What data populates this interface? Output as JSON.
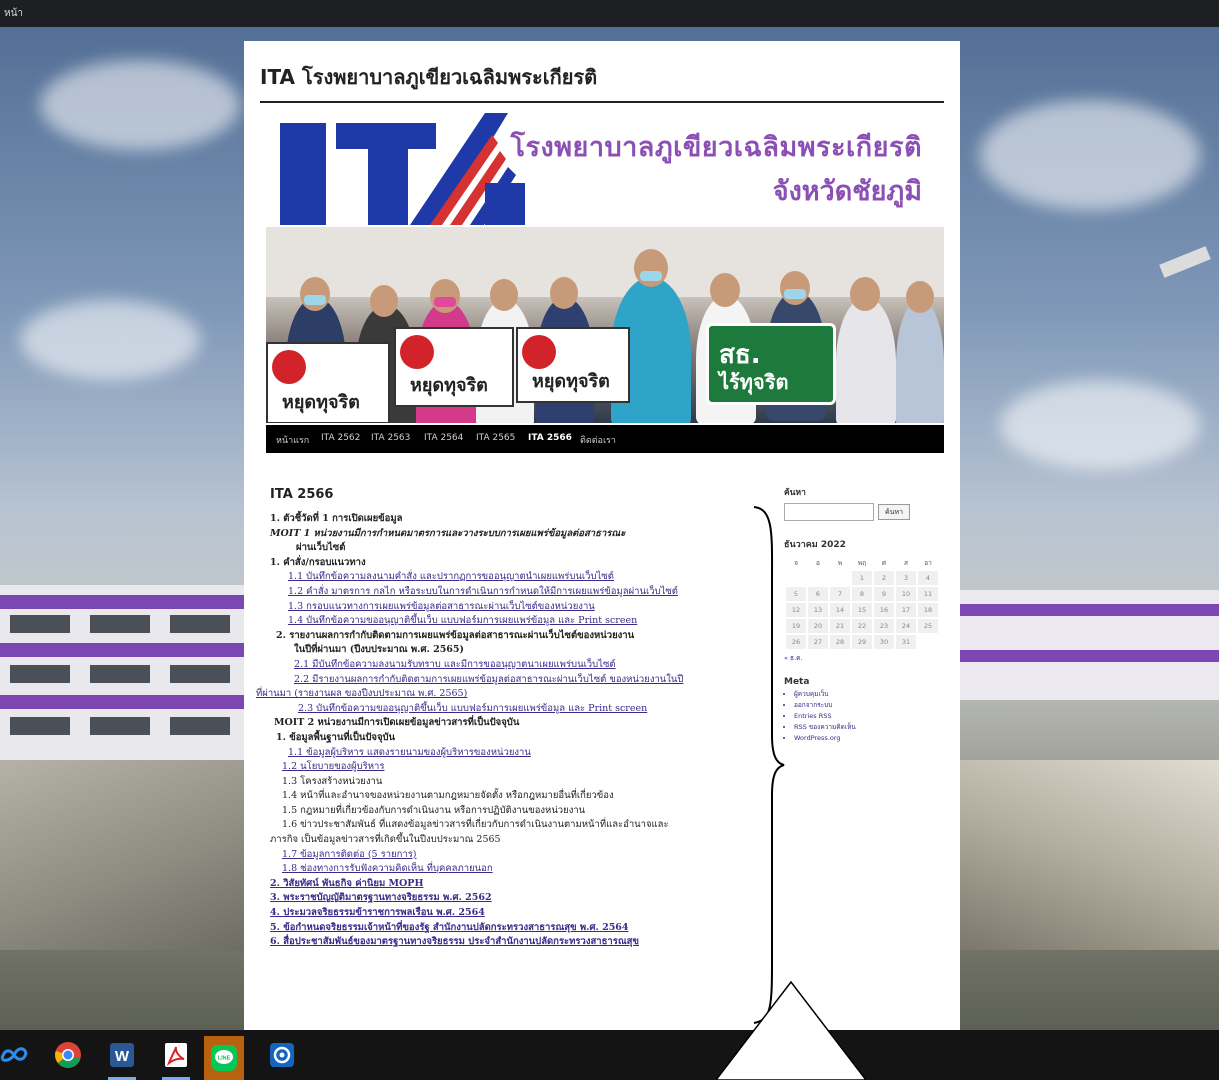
{
  "browser": {
    "tab_text": "หน้า"
  },
  "site": {
    "title": "ITA โรงพยาบาลภูเขียวเฉลิมพระเกียรติ",
    "banner_line1": "โรงพยาบาลภูเขียวเฉลิมพระเกียรติ",
    "banner_line2": "จังหวัดชัยภูมิ",
    "logo_text": "ITA"
  },
  "photo": {
    "sign_text": "หยุดทุจริต",
    "green_sign_1": "สธ.",
    "green_sign_2": "ไร้ทุจริต"
  },
  "nav": {
    "items": [
      "หน้าแรก",
      "ITA 2562",
      "ITA 2563",
      "ITA 2564",
      "ITA 2565",
      "ITA 2566",
      "ติดต่อเรา"
    ],
    "active": "ITA 2566"
  },
  "post": {
    "title": "ITA 2566",
    "lines": [
      "1. ตัวชี้วัดที่ 1 การเปิดเผยข้อมูล",
      "MOIT 1 หน่วยงานมีการกำหนดมาตรการและวางระบบการเผยแพร่ข้อมูลต่อสาธารณะ",
      "ผ่านเว็บไซต์",
      "1. คำสั่ง/กรอบแนวทาง",
      "1.1 บันทึกข้อความลงนามคำสั่ง และปรากฏการขออนุญาตนำเผยแพร่บนเว็บไซต์",
      "1.2 คำสั่ง มาตรการ กลไก หรือระบบในการดำเนินการกำหนดให้มีการเผยแพร่ข้อมูลผ่านเว็บไซต์",
      "1.3 กรอบแนวทางการเผยแพร่ข้อมูลต่อสาธารณะผ่านเว็บไซต์ของหน่วยงาน",
      "1.4 บันทึกข้อความขออนุญาติขึ้นเว็บ แบบฟอร์มการเผยแพร่ข้อมูล และ Print screen",
      "2. รายงานผลการกำกับติดตามการเผยแพร่ข้อมูลต่อสาธารณะผ่านเว็บไซต์ของหน่วยงาน",
      "ในปีที่ผ่านมา (ปีงบประมาณ พ.ศ. 2565)",
      "2.1 มีบันทึกข้อความลงนามรับทราบ และมีการขออนุญาตนาเผยแพร่บนเว็บไซต์",
      "2.2 มีรายงานผลการกำกับติดตามการเผยแพร่ข้อมูลต่อสาธารณะผ่านเว็บไซต์ ของหน่วยงานในปี",
      "ที่ผ่านมา (รายงานผล ของปีงบประมาณ พ.ศ. 2565)",
      "2.3 บันทึกข้อความขออนุญาติขึ้นเว็บ แบบฟอร์มการเผยแพร่ข้อมูล และ Print screen",
      "MOIT 2 หน่วยงานมีการเปิดเผยข้อมูลข่าวสารที่เป็นปัจจุบัน",
      "1. ข้อมูลพื้นฐานที่เป็นปัจจุบัน",
      "1.1 ข้อมูลผู้บริหาร แสดงรายนามของผู้บริหารของหน่วยงาน",
      "1.2 นโยบายของผู้บริหาร",
      "1.3 โครงสร้างหน่วยงาน",
      "1.4 หน้าที่และอำนาจของหน่วยงานตามกฎหมายจัดตั้ง หรือกฎหมายอื่นที่เกี่ยวข้อง",
      "1.5 กฎหมายที่เกี่ยวข้องกับการดำเนินงาน หรือการปฏิบัติงานของหน่วยงาน",
      "1.6 ข่าวประชาสัมพันธ์ ที่แสดงข้อมูลข่าวสารที่เกี่ยวกับการดำเนินงานตามหน้าที่และอำนาจและ",
      "ภารกิจ เป็นข้อมูลข่าวสารที่เกิดขึ้นในปีงบประมาณ 2565",
      "1.7 ข้อมูลการติดต่อ (5 รายการ)",
      "1.8 ช่องทางการรับฟังความคิดเห็น ที่บุคคลภายนอก",
      "2. วิสัยทัศน์ พันธกิจ ค่านิยม MOPH",
      "3. พระราชบัญญัติมาตรฐานทางจริยธรรม พ.ศ. 2562",
      "4. ประมวลจริยธรรมข้าราชการพลเรือน พ.ศ. 2564",
      "5. ข้อกำหนดจริยธรรมเจ้าหน้าที่ของรัฐ สำนักงานปลัดกระทรวงสาธารณสุข พ.ศ. 2564",
      "6. สื่อประชาสัมพันธ์ของมาตรฐานทางจริยธรรม ประจำสำนักงานปลัดกระทรวงสาธารณสุข"
    ]
  },
  "sidebar": {
    "search_heading": "ค้นหา",
    "search_button": "ค้นหา",
    "calendar_title": "ธันวาคม 2022",
    "weekdays": [
      "จ",
      "อ",
      "พ",
      "พฤ",
      "ศ",
      "ส",
      "อา"
    ],
    "weeks": [
      [
        "",
        "",
        "",
        "1",
        "2",
        "3",
        "4"
      ],
      [
        "5",
        "6",
        "7",
        "8",
        "9",
        "10",
        "11"
      ],
      [
        "12",
        "13",
        "14",
        "15",
        "16",
        "17",
        "18"
      ],
      [
        "19",
        "20",
        "21",
        "22",
        "23",
        "24",
        "25"
      ],
      [
        "26",
        "27",
        "28",
        "29",
        "30",
        "31",
        ""
      ]
    ],
    "calendar_prev": "« ธ.ค.",
    "meta_heading": "Meta",
    "meta_items": [
      "ผู้ควบคุมเว็บ",
      "ออกจากระบบ",
      "Entries RSS",
      "RSS ของความคิดเห็น",
      "WordPress.org"
    ]
  },
  "taskbar": {
    "icons": [
      "meta-icon",
      "chrome-icon",
      "word-icon",
      "acrobat-icon",
      "line-icon",
      "app-icon"
    ],
    "line_label": "LINE"
  },
  "colors": {
    "accent_purple": "#8c4fb4",
    "link": "#3c2a8a",
    "nav_bg": "#000000",
    "taskbar_bg": "#141414"
  }
}
